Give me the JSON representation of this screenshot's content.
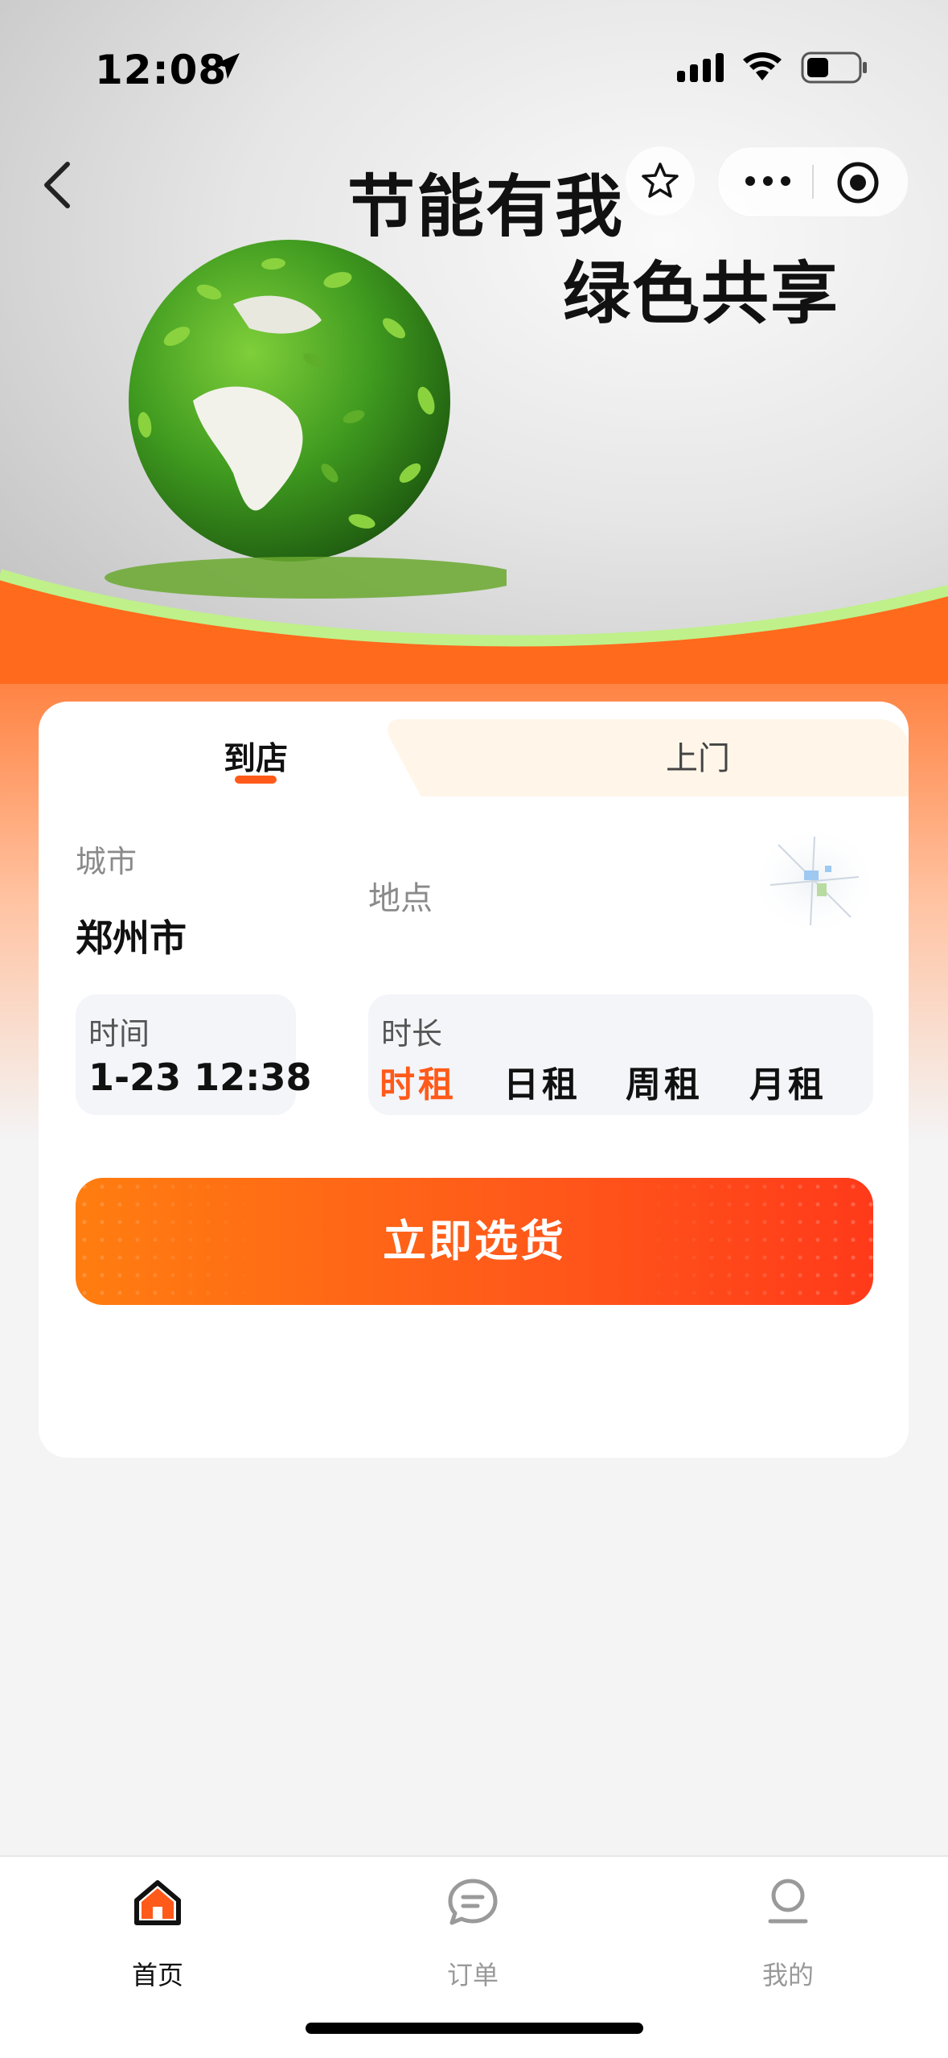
{
  "status_bar": {
    "time": "12:08"
  },
  "banner": {
    "title_line1": "节能有我",
    "title_line2": "绿色共享"
  },
  "booking": {
    "tabs": [
      {
        "label": "到店",
        "active": true
      },
      {
        "label": "上门",
        "active": false
      }
    ],
    "city_label": "城市",
    "city_value": "郑州市",
    "location_placeholder": "地点",
    "time_label": "时间",
    "time_value": "1-23 12:38",
    "duration_label": "时长",
    "duration_options": [
      {
        "label": "时租",
        "active": true
      },
      {
        "label": "日租",
        "active": false
      },
      {
        "label": "周租",
        "active": false
      },
      {
        "label": "月租",
        "active": false
      }
    ],
    "select_button": "立即选货"
  },
  "tabbar": {
    "items": [
      {
        "label": "首页",
        "icon": "home-icon",
        "active": true
      },
      {
        "label": "订单",
        "icon": "message-icon",
        "active": false
      },
      {
        "label": "我的",
        "icon": "profile-icon",
        "active": false
      }
    ]
  },
  "colors": {
    "accent": "#ff5a1a",
    "banner_orange": "#ff6a1d",
    "leaf_green": "#6cbf2a"
  }
}
